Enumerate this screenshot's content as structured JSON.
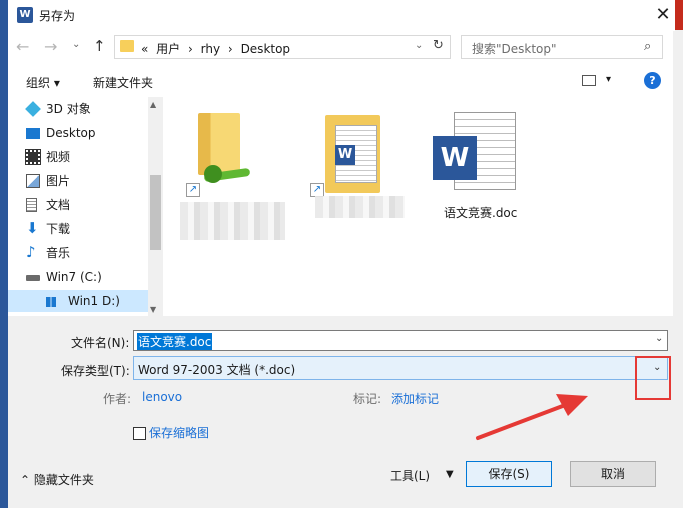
{
  "window": {
    "title": "另存为",
    "app_icon": "W"
  },
  "nav": {
    "back": "←",
    "forward": "→",
    "history": "⌄",
    "up": "↑",
    "path": [
      "«",
      "用户",
      "›",
      "rhy",
      "›",
      "Desktop"
    ],
    "refresh": "↻",
    "search_placeholder": "搜索\"Desktop\""
  },
  "toolbar": {
    "organize": "组织 ▾",
    "new_folder": "新建文件夹",
    "view_dd": "▾",
    "help": "?"
  },
  "sidebar": {
    "items": [
      {
        "label": "3D 对象",
        "icon": "cube-icon"
      },
      {
        "label": "Desktop",
        "icon": "desktop-icon"
      },
      {
        "label": "视频",
        "icon": "video-icon"
      },
      {
        "label": "图片",
        "icon": "pictures-icon"
      },
      {
        "label": "文档",
        "icon": "documents-icon"
      },
      {
        "label": "下载",
        "icon": "download-icon"
      },
      {
        "label": "音乐",
        "icon": "music-icon"
      },
      {
        "label": "Win7 (C:)",
        "icon": "drive-icon"
      },
      {
        "label": "Win1    D:)",
        "icon": "drive-icon"
      }
    ],
    "selected_index": 8
  },
  "files": [
    {
      "label": "",
      "type": "folder-shortcut"
    },
    {
      "label": "",
      "type": "folder-shortcut-doc"
    },
    {
      "label": "语文竞赛.doc",
      "type": "word-doc"
    }
  ],
  "form": {
    "filename_label": "文件名(N):",
    "filename_value": "语文竞赛.doc",
    "filetype_label": "保存类型(T):",
    "filetype_value": "Word 97-2003 文档 (*.doc)",
    "author_label": "作者:",
    "author_value": "lenovo",
    "tags_label": "标记:",
    "tags_value": "添加标记",
    "thumbnail_label": "保存缩略图"
  },
  "footer": {
    "hide_folders": "隐藏文件夹",
    "tools": "工具(L)",
    "save": "保存(S)",
    "cancel": "取消"
  },
  "colors": {
    "accent": "#0078d7",
    "annotation": "#e53935",
    "link": "#1a6fd6"
  }
}
